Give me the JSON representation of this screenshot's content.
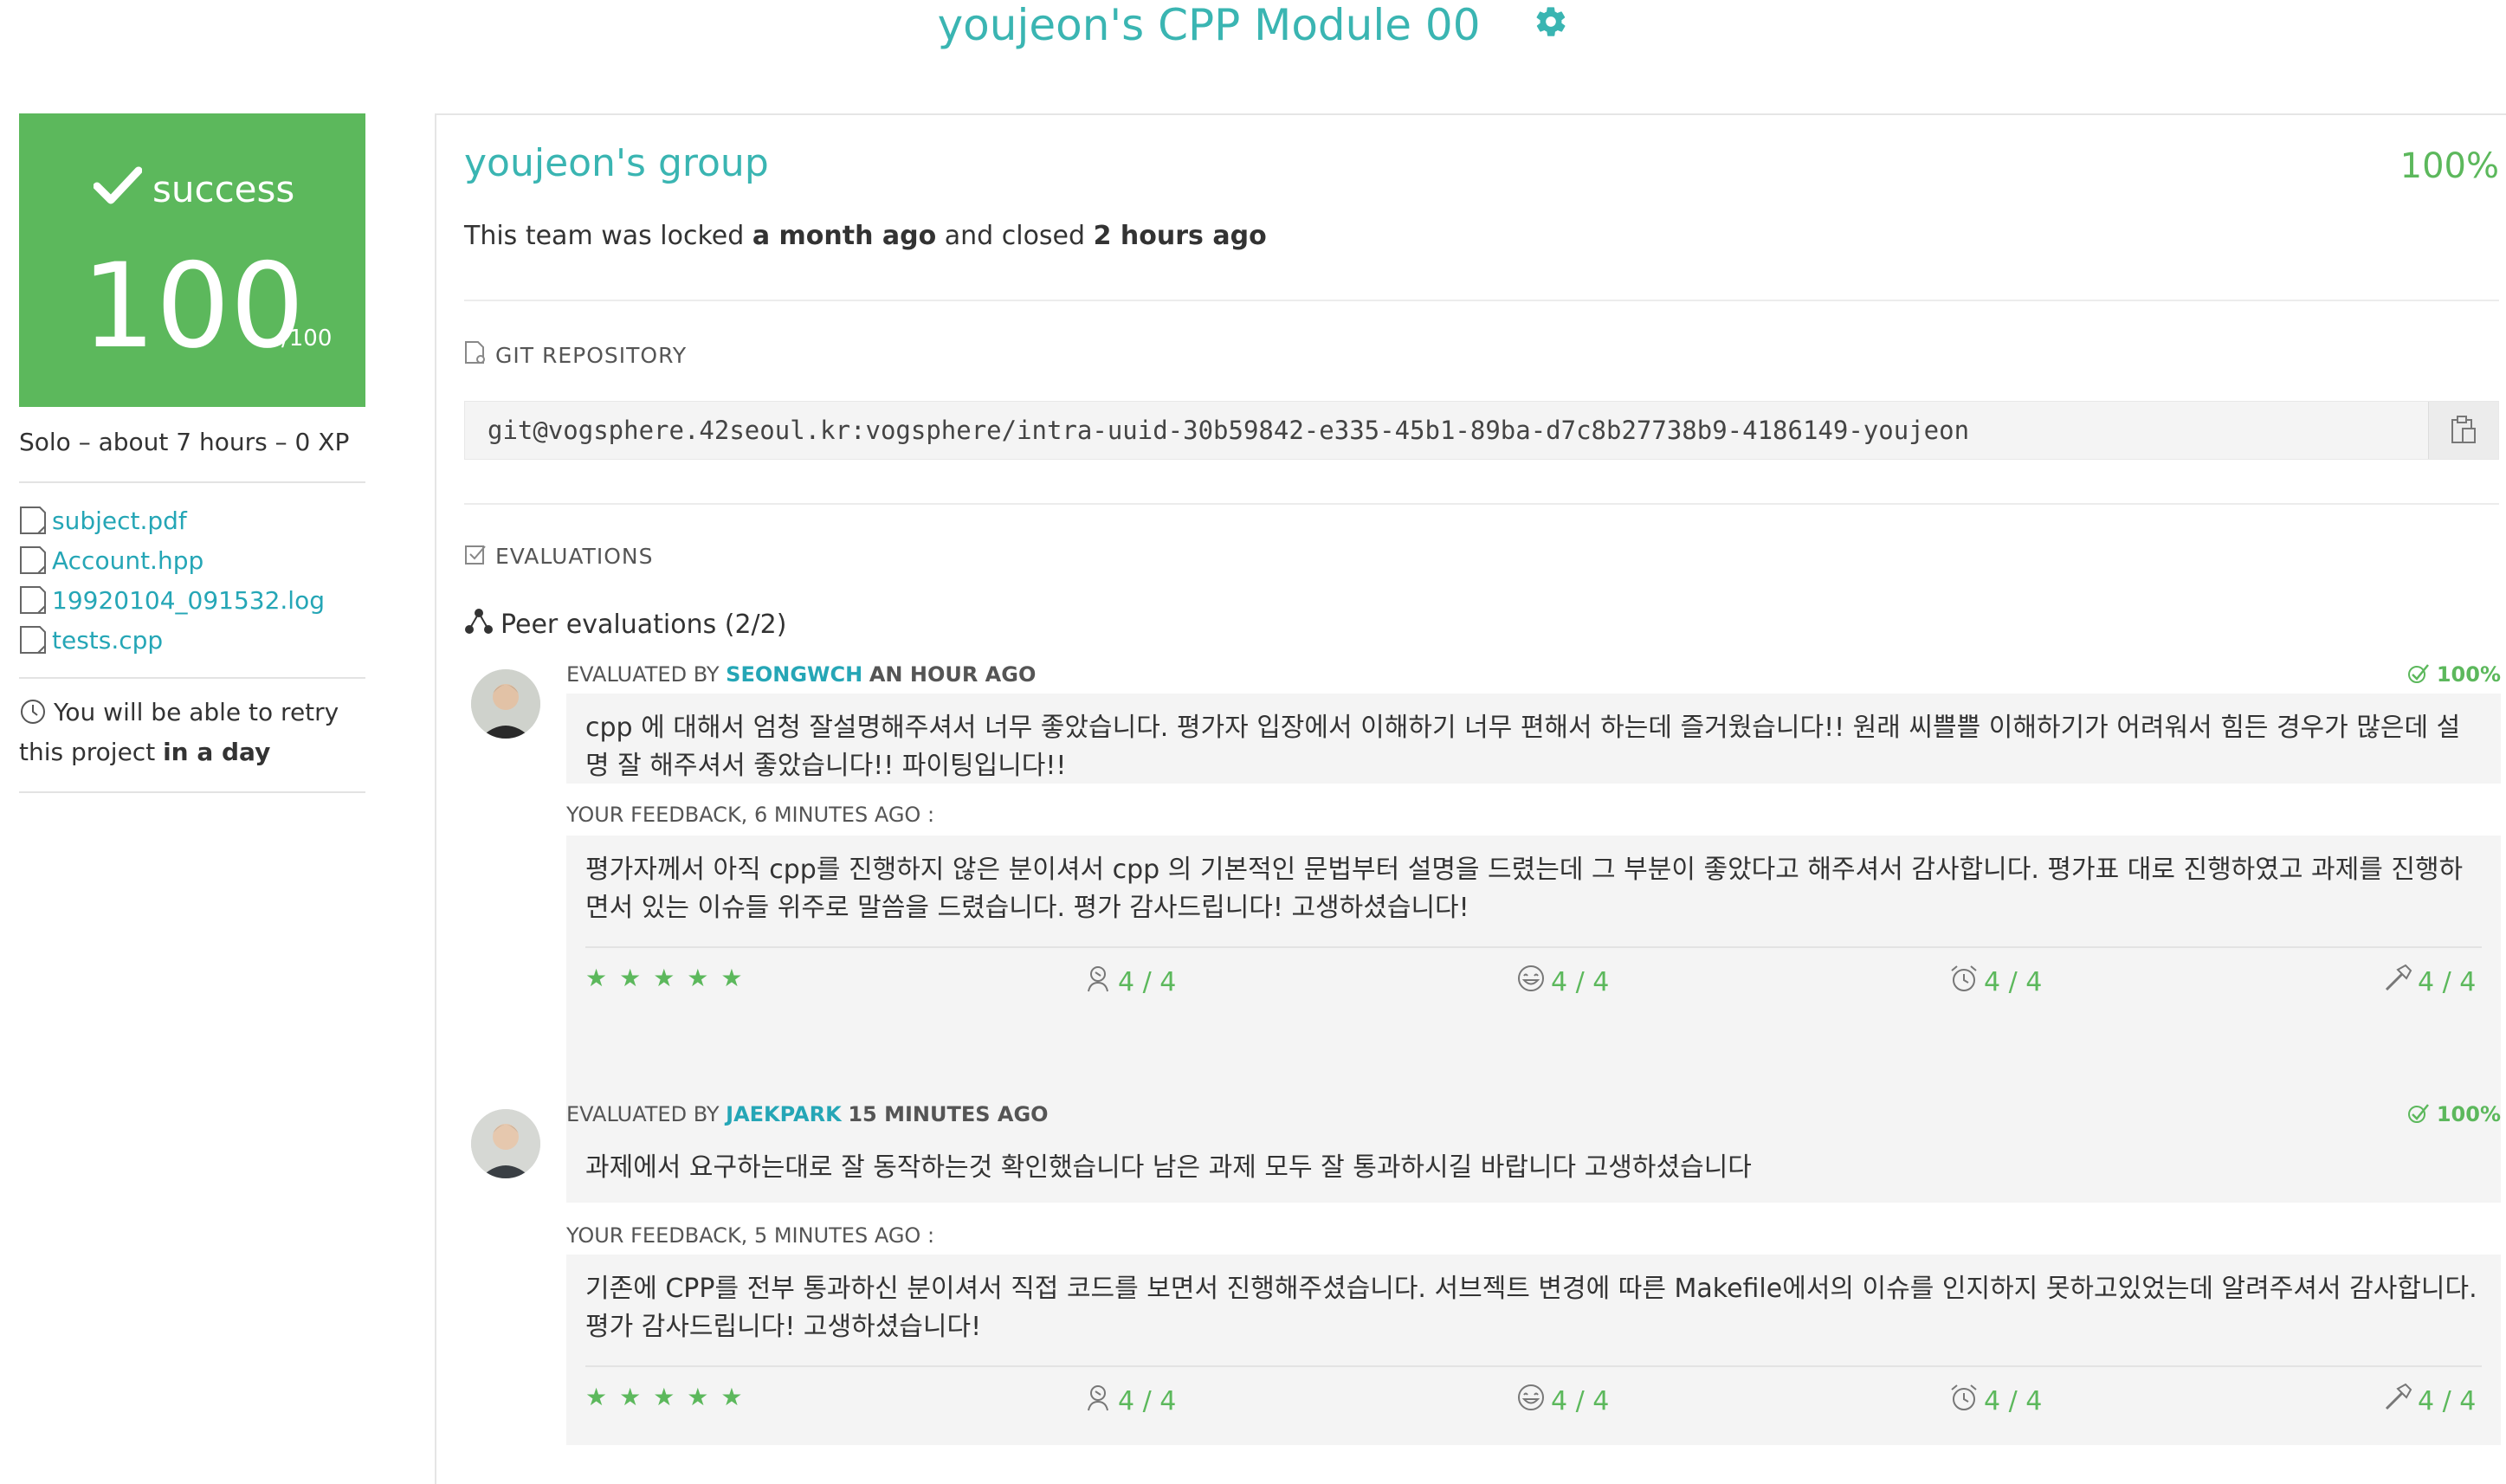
{
  "header": {
    "title": "youjeon's CPP Module 00",
    "settings_icon": "gear-icon"
  },
  "score": {
    "status": "success",
    "value": "100",
    "max": "/100"
  },
  "project_info": "Solo – about 7 hours – 0 XP",
  "files": [
    "subject.pdf",
    "Account.hpp",
    "19920104_091532.log",
    "tests.cpp"
  ],
  "retry": {
    "prefix": "You will be able to retry this project",
    "bold": "in a day"
  },
  "team": {
    "name": "youjeon's group",
    "percent": "100%",
    "locked_prefix": "This team was locked",
    "locked_when": "a month ago",
    "closed_prefix": "and closed",
    "closed_when": "2 hours ago"
  },
  "git": {
    "label": "GIT REPOSITORY",
    "url": "git@vogsphere.42seoul.kr:vogsphere/intra-uuid-30b59842-e335-45b1-89ba-d7c8b27738b9-4186149-youjeon"
  },
  "evaluations_label": "EVALUATIONS",
  "peer_title": "Peer evaluations (2/2)",
  "evaluations": [
    {
      "by_label": "EVALUATED BY",
      "login": "SEONGWCH",
      "when": "AN HOUR AGO",
      "percent": "100%",
      "comment": "cpp 에 대해서 엄청 잘설명해주셔서 너무 좋았습니다. 평가자 입장에서 이해하기 너무 편해서 하는데 즐거웠습니다!! 원래 씨쁠쁠 이해하기가 어려워서 힘든 경우가 많은데 설명 잘 해주셔서 좋았습니다!! 파이팅입니다!!",
      "feedback_label": "YOUR FEEDBACK, 6 MINUTES AGO :",
      "feedback": "평가자께서 아직 cpp를 진행하지 않은 분이셔서 cpp 의 기본적인 문법부터 설명을 드렸는데 그 부분이 좋았다고 해주셔서 감사합니다. 평가표 대로 진행하였고 과제를 진행하면서 있는 이슈들 위주로 말씀을 드렸습니다. 평가 감사드립니다! 고생하셨습니다!",
      "stars": "★★★★★",
      "ratings": [
        "4 / 4",
        "4 / 4",
        "4 / 4",
        "4 / 4"
      ]
    },
    {
      "by_label": "EVALUATED BY",
      "login": "JAEKPARK",
      "when": "15 MINUTES AGO",
      "percent": "100%",
      "comment": "과제에서 요구하는대로 잘 동작하는것 확인했습니다 남은 과제 모두 잘 통과하시길 바랍니다 고생하셨습니다",
      "feedback_label": "YOUR FEEDBACK, 5 MINUTES AGO :",
      "feedback": "기존에 CPP를 전부 통과하신 분이셔서 직접 코드를 보면서 진행해주셨습니다. 서브젝트 변경에 따른 Makefile에서의 이슈를 인지하지 못하고있었는데 알려주셔서 감사합니다. 평가 감사드립니다! 고생하셨습니다!",
      "stars": "★★★★★",
      "ratings": [
        "4 / 4",
        "4 / 4",
        "4 / 4",
        "4 / 4"
      ]
    }
  ],
  "colors": {
    "accent": "#3ab5b2",
    "success": "#5cb85c",
    "link": "#25a6b6"
  }
}
